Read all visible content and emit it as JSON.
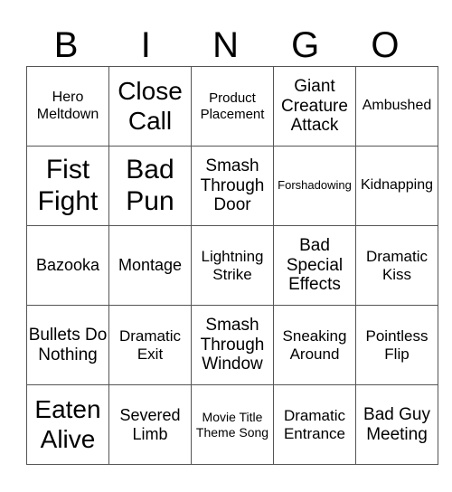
{
  "header": [
    "B",
    "I",
    "N",
    "G",
    "O"
  ],
  "rows": [
    [
      "Hero Meltdown",
      "Close Call",
      "Product Placement",
      "Giant Creature Attack",
      "Ambushed"
    ],
    [
      "Fist Fight",
      "Bad Pun",
      "Smash Through Door",
      "Forshadowing",
      "Kidnapping"
    ],
    [
      "Bazooka",
      "Montage",
      "Lightning Strike",
      "Bad Special Effects",
      "Dramatic Kiss"
    ],
    [
      "Bullets Do Nothing",
      "Dramatic Exit",
      "Smash Through Window",
      "Sneaking Around",
      "Pointless Flip"
    ],
    [
      "Eaten Alive",
      "Severed Limb",
      "Movie Title Theme Song",
      "Dramatic Entrance",
      "Bad Guy Meeting"
    ]
  ]
}
